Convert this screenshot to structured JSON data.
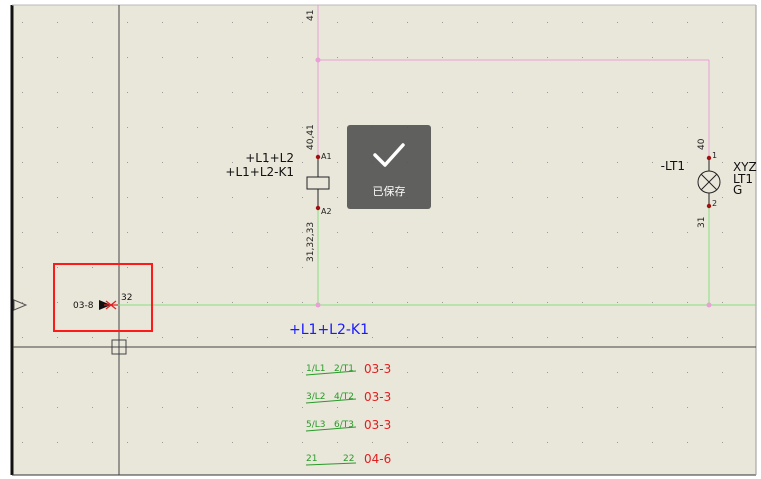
{
  "schematic": {
    "top_wire_number": "41",
    "coil": {
      "pin_numbers_top": "40,41",
      "pin_numbers_bottom": "31,32,33",
      "tag_line1": "+L1+L2",
      "tag_line2": "+L1+L2-K1",
      "pin_a1": "A1",
      "pin_a2": "A2"
    },
    "lamp": {
      "tag": "-LT1",
      "wire_top": "40",
      "wire_bottom": "31",
      "pin1": "1",
      "pin2": "2",
      "side_label_1": "XYZ",
      "side_label_2": "LT1",
      "side_label_3": "G"
    },
    "crossref": {
      "source": "03-8",
      "wire_number": "32"
    },
    "device_label": "+L1+L2-K1",
    "contacts": [
      {
        "left": "1/L1",
        "right": "2/T1",
        "ref": "03-3"
      },
      {
        "left": "3/L2",
        "right": "4/T2",
        "ref": "03-3"
      },
      {
        "left": "5/L3",
        "right": "6/T3",
        "ref": "03-3"
      },
      {
        "left": "21",
        "right": "22",
        "ref": "04-6"
      }
    ]
  },
  "toast": {
    "icon": "checkmark-icon",
    "message": "已保存"
  },
  "colors": {
    "background": "#e9e6da",
    "grid_dot": "#9a9a9a",
    "pink_wire": "#e9a0d6",
    "green_wire": "#88e080",
    "node": "#b0189a",
    "pin_dot": "#a01010",
    "ref_red": "#e02020",
    "device_blue": "#1a1aff",
    "contact_green": "#2a9a2a",
    "selection": "#ff1a1a"
  }
}
